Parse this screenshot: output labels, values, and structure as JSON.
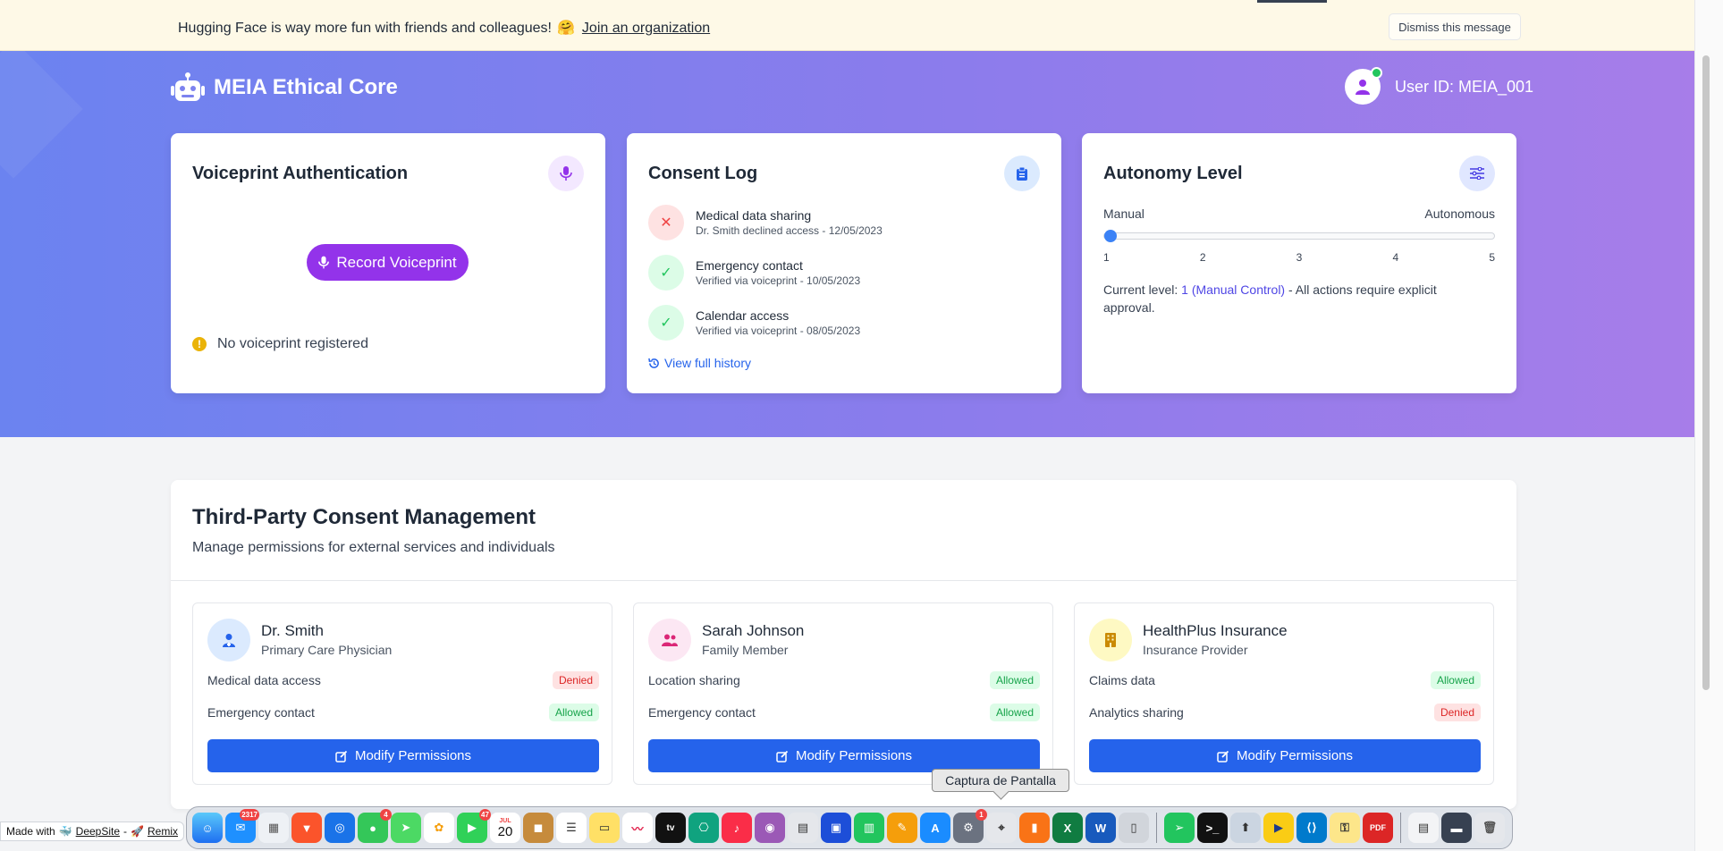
{
  "banner": {
    "text": "Hugging Face is way more fun with friends and colleagues!",
    "emoji": "🤗",
    "link": "Join an organization",
    "dismiss": "Dismiss this message"
  },
  "header": {
    "brand": "MEIA Ethical Core",
    "brand_icon": "robot-icon",
    "user_id": "User ID: MEIA_001",
    "online_color": "#22c55e"
  },
  "voiceprint": {
    "title": "Voiceprint Authentication",
    "button": "Record Voiceprint",
    "status": "No voiceprint registered",
    "accent": "#9333ea"
  },
  "consent_log": {
    "title": "Consent Log",
    "items": [
      {
        "title": "Medical data sharing",
        "sub": "Dr. Smith declined access - 12/05/2023",
        "status": "denied"
      },
      {
        "title": "Emergency contact",
        "sub": "Verified via voiceprint - 10/05/2023",
        "status": "allowed"
      },
      {
        "title": "Calendar access",
        "sub": "Verified via voiceprint - 08/05/2023",
        "status": "allowed"
      }
    ],
    "history_link": "View full history"
  },
  "autonomy": {
    "title": "Autonomy Level",
    "min_label": "Manual",
    "max_label": "Autonomous",
    "ticks": [
      "1",
      "2",
      "3",
      "4",
      "5"
    ],
    "value": 1,
    "desc_prefix": "Current level:",
    "level_text": "1 (Manual Control)",
    "desc_suffix": "- All actions require explicit approval."
  },
  "third_party": {
    "title": "Third-Party Consent Management",
    "subtitle": "Manage permissions for external services and individuals",
    "modify_label": "Modify Permissions",
    "parties": [
      {
        "name": "Dr. Smith",
        "role": "Primary Care Physician",
        "icon": "doctor-icon",
        "perms": [
          {
            "label": "Medical data access",
            "status": "Denied"
          },
          {
            "label": "Emergency contact",
            "status": "Allowed"
          }
        ]
      },
      {
        "name": "Sarah Johnson",
        "role": "Family Member",
        "icon": "users-icon",
        "perms": [
          {
            "label": "Location sharing",
            "status": "Allowed"
          },
          {
            "label": "Emergency contact",
            "status": "Allowed"
          }
        ]
      },
      {
        "name": "HealthPlus Insurance",
        "role": "Insurance Provider",
        "icon": "building-icon",
        "perms": [
          {
            "label": "Claims data",
            "status": "Allowed"
          },
          {
            "label": "Analytics sharing",
            "status": "Denied"
          }
        ]
      }
    ]
  },
  "tooltip": "Captura de Pantalla",
  "madewith": {
    "prefix": "Made with",
    "deepsite": "DeepSite",
    "remix": "Remix"
  },
  "dock": {
    "calendar_month": "JUL",
    "calendar_day": "20",
    "mail_badge": "2317",
    "messages_badge": "4",
    "facetime_badge": "47",
    "settings_badge": "1"
  }
}
